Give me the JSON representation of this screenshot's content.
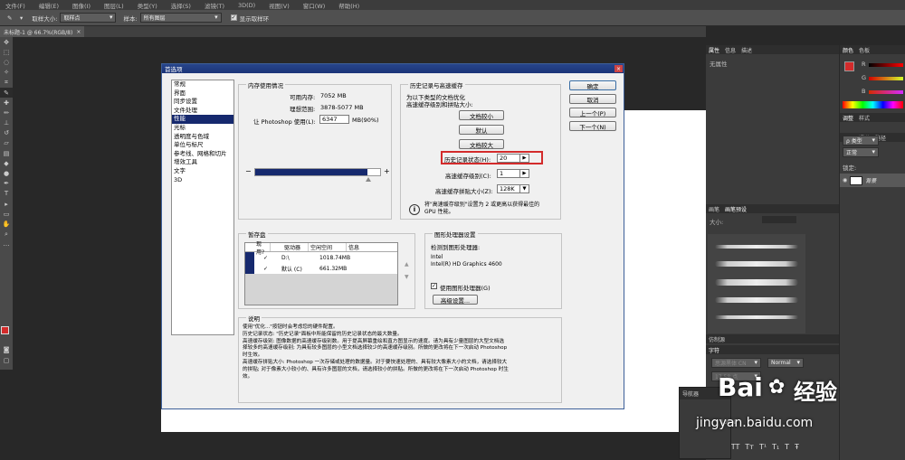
{
  "menubar": [
    "文件(F)",
    "编辑(E)",
    "图像(I)",
    "图层(L)",
    "类型(Y)",
    "选择(S)",
    "滤镜(T)",
    "3D(D)",
    "视图(V)",
    "窗口(W)",
    "帮助(H)"
  ],
  "optbar": {
    "sample_size_label": "取样大小:",
    "sample_size_value": "取样点",
    "sample_label": "样本:",
    "sample_value": "所有图层",
    "ring_label": "显示取样环"
  },
  "document_tab": {
    "title": "未标题-1 @ 66.7%(RGB/8)",
    "close": "×"
  },
  "dialog": {
    "title": "首选项",
    "close": "×",
    "categories": [
      "常规",
      "界面",
      "同步设置",
      "文件处理",
      "性能",
      "光标",
      "透明度与色域",
      "单位与标尺",
      "参考线、网格和切片",
      "增效工具",
      "文字",
      "3D"
    ],
    "selected_index": 4,
    "buttons": {
      "ok": "确定",
      "cancel": "取消",
      "prev": "上一个(P)",
      "next": "下一个(N)"
    },
    "memory": {
      "title": "内存使用情况",
      "available_label": "可用内存:",
      "available_value": "7052 MB",
      "ideal_label": "理想范围:",
      "ideal_value": "3878-5077 MB",
      "use_label": "让 Photoshop 使用(L):",
      "use_value": "6347",
      "use_unit": "MB(90%)",
      "slider_percent": 90,
      "minus": "−",
      "plus": "+"
    },
    "history": {
      "title": "历史记录与高速缓存",
      "desc1": "为以下类型的文档优化",
      "desc2": "高速缓存级别和拼贴大小:",
      "btn_tall": "文档较小",
      "btn_default": "默认",
      "btn_big": "文档较大",
      "states_label": "历史记录状态(H):",
      "states_value": "20",
      "cache_levels_label": "高速缓存级别(C):",
      "cache_levels_value": "1",
      "tile_label": "高速缓存拼贴大小(Z):",
      "tile_value": "128K",
      "note1": "将\"高速缓存级别\"设置为 2 或更高以获得最佳的",
      "note2": "GPU 性能。",
      "info_icon": "i"
    },
    "scratch": {
      "title": "暂存盘",
      "headers": [
        "现用?",
        "驱动器",
        "空闲空间",
        "信息"
      ],
      "rows": [
        {
          "drive": "D:\\",
          "free": "1018.74MB",
          "info": ""
        },
        {
          "drive": "默认 (C)",
          "free": "661.32MB",
          "info": ""
        }
      ]
    },
    "gpu": {
      "title": "图形处理器设置",
      "detected_label": "检测到图形处理器:",
      "vendor": "Intel",
      "model": "Intel(R) HD Graphics 4600",
      "use_gpu_label": "使用图形处理器(G)",
      "advanced_btn": "高级设置..."
    },
    "description": {
      "title": "说明",
      "lines": [
        "使用\"优化...\"按钮时会考虑您的硬件配置。",
        "历史记录状态: \"历史记录\"面板中所能保留的历史记录状态的最大数量。",
        "高速缓存级别: 图像数据的高速缓存级别数。用于提高屏幕重绘和直方图显示的速度。请为具有少量图层的大型文档选",
        "择较多的高速缓存级别; 为具有较多图层的小型文档选择较少的高速缓存级别。所做的更改将在下一次启动 Photoshop",
        "时生效。",
        "高速缓存拼贴大小: Photoshop 一次存储或处理的数据量。对于要快速处理的、具有较大像素大小的文档，请选择较大",
        "的拼贴; 对于像素大小较小的、具有许多图层的文档，请选择较小的拼贴。所做的更改将在下一次启动 Photoshop 时生",
        "效。"
      ]
    }
  },
  "panels": {
    "properties_tabs": [
      "属性",
      "信息",
      "描述"
    ],
    "no_properties": "无属性",
    "color_tabs": [
      "颜色",
      "色板"
    ],
    "color_channels": [
      "R",
      "G",
      "B"
    ],
    "adjust_tabs": [
      "调整",
      "样式"
    ],
    "layers_tabs": [
      "图层",
      "通道",
      "路径"
    ],
    "layer_kind": "ρ 类型",
    "blend_mode": "正常",
    "lock_label": "锁定:",
    "layer_name": "背景",
    "brush_tabs": [
      "画笔",
      "画笔预设"
    ],
    "brush_size_label": "大小:",
    "history_tab": "仿制源",
    "char_tab": "字符",
    "font_family": "思源黑体 CN",
    "font_style": "Normal",
    "font_size": "17.58 点",
    "scale_label": "100%",
    "nav_tab": "导航器",
    "accent_color": "#d32b2b"
  },
  "watermark": {
    "logo": "Bai",
    "logo2": "经验",
    "url": "jingyan.baidu.com"
  }
}
